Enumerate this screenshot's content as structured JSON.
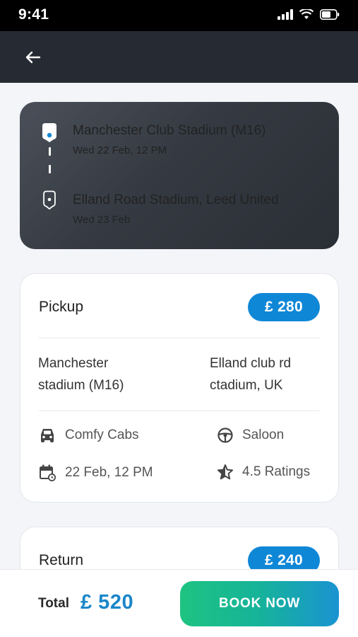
{
  "status_bar": {
    "time": "9:41"
  },
  "route": {
    "origin": {
      "name": "Manchester Club Stadium (M16)",
      "date": "Wed 22 Feb, 12 PM"
    },
    "destination": {
      "name": "Elland Road Stadium, Leed United",
      "date": "Wed 23 Feb"
    }
  },
  "pickup": {
    "title": "Pickup",
    "price": "£ 280",
    "from_line1": "Manchester",
    "from_line2": "stadium (M16)",
    "to_line1": "Elland club rd",
    "to_line2": "ctadium, UK",
    "company": "Comfy Cabs",
    "vehicle": "Saloon",
    "datetime": "22 Feb, 12 PM",
    "rating": "4.5 Ratings"
  },
  "return_trip": {
    "title": "Return",
    "price": "£ 240"
  },
  "footer": {
    "total_label": "Total",
    "total_amount": "£ 520",
    "book_label": "BOOK NOW"
  },
  "colors": {
    "accent_blue": "#0f87d7",
    "header_dark": "#262b33",
    "book_green": "#1ec381"
  }
}
